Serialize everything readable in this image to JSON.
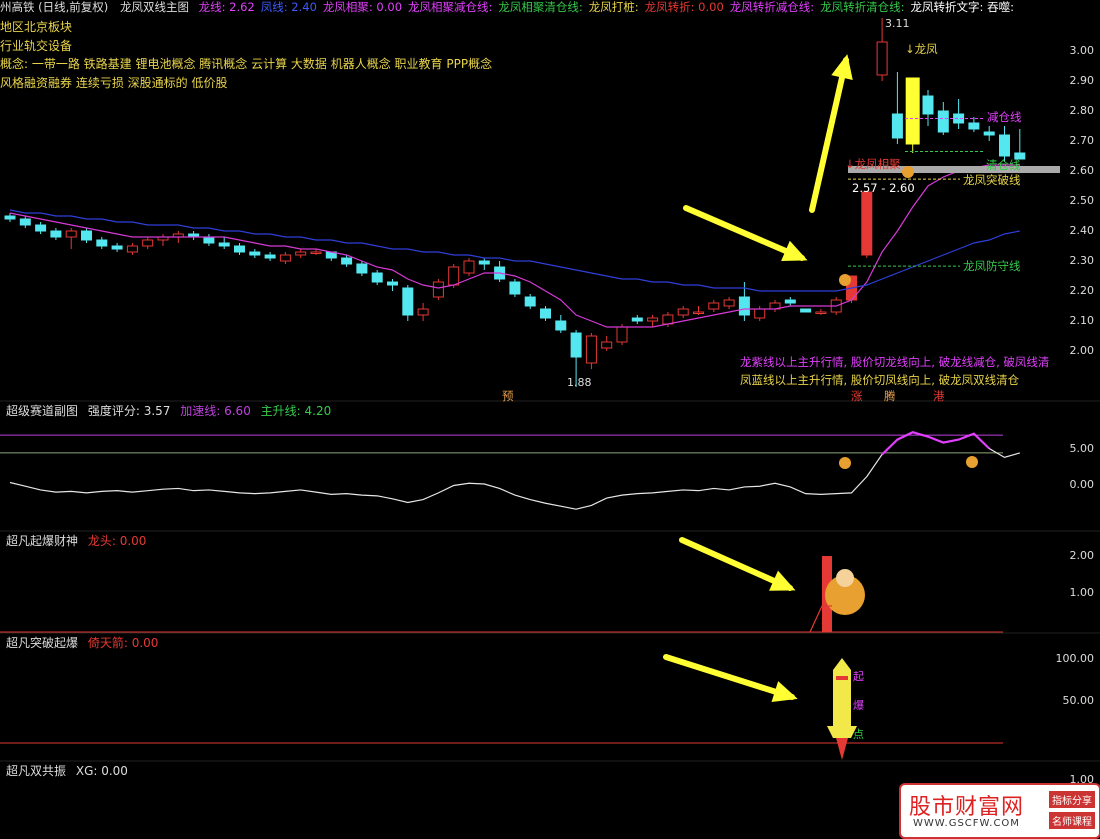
{
  "header": {
    "prefix": "州高铁 (日线,前复权)",
    "title": "龙凤双线主图",
    "items": [
      {
        "label": "龙线: 2.62",
        "color": "#e040fb"
      },
      {
        "label": "凤线: 2.40",
        "color": "#3b5bff"
      },
      {
        "label": "龙凤相聚: 0.00",
        "color": "#e040fb"
      },
      {
        "label": "龙凤相聚减仓线:",
        "color": "#e040fb"
      },
      {
        "label": "龙凤相聚清仓线:",
        "color": "#35c94b"
      },
      {
        "label": "龙凤打桩:",
        "color": "#e8d44a"
      },
      {
        "label": "龙凤转折: 0.00",
        "color": "#e53935"
      },
      {
        "label": "龙凤转折减仓线:",
        "color": "#e040fb"
      },
      {
        "label": "龙凤转折清仓线:",
        "color": "#35c94b"
      },
      {
        "label": "龙凤转折文字: 吞噬:",
        "color": "#ffffff"
      }
    ]
  },
  "concepts": [
    "地区北京板块",
    "行业轨交设备",
    "概念: 一带一路 铁路基建 锂电池概念 腾讯概念 云计算 大数据 机器人概念 职业教育 PPP概念",
    "风格融资融券 连续亏损 深股通标的 低价股"
  ],
  "main_annotations": {
    "high": "3.11",
    "low": "1.88",
    "longfeng": "↓龙凤",
    "xiangju": "↓龙凤相聚",
    "range": "2.57 - 2.60",
    "jiancang": "减仓线",
    "qingcang": "清仓线",
    "tupo": "龙凤突破线",
    "fangshou": "龙凤防守线",
    "note1": "龙紫线以上主升行情, 股价切龙线向上, 破龙线减仓, 破凤线清",
    "note2": "凤蓝线以上主升行情, 股价切凤线向上, 破龙凤双线清仓",
    "marker_yu": "预",
    "marker_zhang": "涨",
    "marker_teng": "腾",
    "marker_gang": "港"
  },
  "yaxis_main": [
    "3.00",
    "2.90",
    "2.80",
    "2.70",
    "2.60",
    "2.50",
    "2.40",
    "2.30",
    "2.20",
    "2.10",
    "2.00"
  ],
  "panel2": {
    "title": "超级赛道副图",
    "score": "强度评分: 3.57",
    "accel": "加速线: 6.60",
    "main": "主升线: 4.20",
    "yaxis": [
      "5.00",
      "0.00"
    ]
  },
  "panel3": {
    "title": "超凡起爆财神",
    "value": "龙头: 0.00",
    "yaxis": [
      "2.00",
      "1.00"
    ]
  },
  "panel4": {
    "title": "超凡突破起爆",
    "value": "倚天箭: 0.00",
    "yaxis": [
      "100.00",
      "50.00"
    ],
    "rocket_labels": [
      "起",
      "爆",
      "点"
    ]
  },
  "panel5": {
    "title": "超凡双共振",
    "value": "XG: 0.00",
    "yaxis": [
      "1.00"
    ]
  },
  "watermark": {
    "cn": "股市财富网",
    "url": "WWW.GSCFW.COM",
    "tag1": "指标分享",
    "tag2": "名师课程"
  },
  "colors": {
    "up": "#e53935",
    "down": "#54e7f0",
    "long": "#d63ad6",
    "feng": "#2f3fd8",
    "yellow": "#ffff33",
    "accel": "#c040e0",
    "mainline": "#8fa878"
  },
  "chart_data": {
    "type": "candlestick",
    "ohlc": [
      [
        2.45,
        2.46,
        2.43,
        2.44
      ],
      [
        2.44,
        2.45,
        2.41,
        2.42
      ],
      [
        2.42,
        2.43,
        2.39,
        2.4
      ],
      [
        2.4,
        2.41,
        2.37,
        2.38
      ],
      [
        2.38,
        2.41,
        2.34,
        2.4
      ],
      [
        2.4,
        2.41,
        2.36,
        2.37
      ],
      [
        2.37,
        2.38,
        2.34,
        2.35
      ],
      [
        2.35,
        2.36,
        2.33,
        2.34
      ],
      [
        2.33,
        2.36,
        2.32,
        2.35
      ],
      [
        2.35,
        2.38,
        2.34,
        2.37
      ],
      [
        2.37,
        2.39,
        2.35,
        2.38
      ],
      [
        2.38,
        2.4,
        2.36,
        2.39
      ],
      [
        2.39,
        2.4,
        2.37,
        2.38
      ],
      [
        2.38,
        2.39,
        2.35,
        2.36
      ],
      [
        2.36,
        2.38,
        2.34,
        2.35
      ],
      [
        2.35,
        2.36,
        2.32,
        2.33
      ],
      [
        2.33,
        2.34,
        2.31,
        2.32
      ],
      [
        2.32,
        2.33,
        2.3,
        2.31
      ],
      [
        2.3,
        2.33,
        2.29,
        2.32
      ],
      [
        2.32,
        2.34,
        2.31,
        2.33
      ],
      [
        2.33,
        2.34,
        2.32,
        2.33
      ],
      [
        2.33,
        2.33,
        2.3,
        2.31
      ],
      [
        2.31,
        2.32,
        2.28,
        2.29
      ],
      [
        2.29,
        2.3,
        2.25,
        2.26
      ],
      [
        2.26,
        2.27,
        2.22,
        2.23
      ],
      [
        2.23,
        2.24,
        2.2,
        2.22
      ],
      [
        2.21,
        2.22,
        2.1,
        2.12
      ],
      [
        2.12,
        2.16,
        2.1,
        2.14
      ],
      [
        2.18,
        2.24,
        2.17,
        2.23
      ],
      [
        2.22,
        2.29,
        2.21,
        2.28
      ],
      [
        2.26,
        2.31,
        2.25,
        2.3
      ],
      [
        2.3,
        2.31,
        2.27,
        2.29
      ],
      [
        2.28,
        2.3,
        2.23,
        2.24
      ],
      [
        2.23,
        2.24,
        2.18,
        2.19
      ],
      [
        2.18,
        2.19,
        2.14,
        2.15
      ],
      [
        2.14,
        2.15,
        2.1,
        2.11
      ],
      [
        2.1,
        2.12,
        2.06,
        2.07
      ],
      [
        2.06,
        2.07,
        1.88,
        1.98
      ],
      [
        1.96,
        2.06,
        1.94,
        2.05
      ],
      [
        2.01,
        2.05,
        2.0,
        2.03
      ],
      [
        2.03,
        2.09,
        2.02,
        2.08
      ],
      [
        2.11,
        2.12,
        2.09,
        2.1
      ],
      [
        2.1,
        2.12,
        2.08,
        2.11
      ],
      [
        2.09,
        2.13,
        2.08,
        2.12
      ],
      [
        2.12,
        2.15,
        2.11,
        2.14
      ],
      [
        2.13,
        2.15,
        2.12,
        2.13
      ],
      [
        2.14,
        2.17,
        2.13,
        2.16
      ],
      [
        2.15,
        2.18,
        2.14,
        2.17
      ],
      [
        2.18,
        2.23,
        2.1,
        2.12
      ],
      [
        2.11,
        2.15,
        2.1,
        2.14
      ],
      [
        2.14,
        2.17,
        2.13,
        2.16
      ],
      [
        2.17,
        2.18,
        2.15,
        2.16
      ],
      [
        2.14,
        2.14,
        2.13,
        2.13
      ],
      [
        2.13,
        2.14,
        2.12,
        2.13
      ],
      [
        2.13,
        2.18,
        2.12,
        2.17
      ],
      [
        2.17,
        2.25,
        2.16,
        2.25
      ],
      [
        2.32,
        2.53,
        2.31,
        2.53
      ],
      [
        2.92,
        3.11,
        2.9,
        3.03
      ],
      [
        2.79,
        2.93,
        2.69,
        2.71
      ],
      [
        2.69,
        2.9,
        2.66,
        2.91
      ],
      [
        2.85,
        2.87,
        2.75,
        2.79
      ],
      [
        2.8,
        2.83,
        2.72,
        2.73
      ],
      [
        2.79,
        2.84,
        2.74,
        2.76
      ],
      [
        2.76,
        2.78,
        2.73,
        2.74
      ],
      [
        2.73,
        2.75,
        2.7,
        2.72
      ],
      [
        2.72,
        2.75,
        2.63,
        2.65
      ],
      [
        2.66,
        2.74,
        2.64,
        2.64
      ]
    ],
    "long_line": [
      2.46,
      2.45,
      2.44,
      2.43,
      2.42,
      2.41,
      2.4,
      2.39,
      2.38,
      2.38,
      2.38,
      2.38,
      2.38,
      2.38,
      2.38,
      2.37,
      2.36,
      2.35,
      2.35,
      2.34,
      2.34,
      2.33,
      2.32,
      2.3,
      2.28,
      2.27,
      2.24,
      2.22,
      2.21,
      2.22,
      2.24,
      2.26,
      2.26,
      2.25,
      2.23,
      2.2,
      2.17,
      2.12,
      2.1,
      2.08,
      2.08,
      2.08,
      2.08,
      2.09,
      2.1,
      2.11,
      2.12,
      2.13,
      2.14,
      2.14,
      2.14,
      2.15,
      2.15,
      2.15,
      2.15,
      2.17,
      2.23,
      2.33,
      2.4,
      2.48,
      2.55,
      2.58,
      2.6,
      2.61,
      2.62,
      2.62,
      2.62
    ],
    "feng_line": [
      2.47,
      2.46,
      2.46,
      2.45,
      2.45,
      2.44,
      2.44,
      2.43,
      2.43,
      2.42,
      2.42,
      2.42,
      2.41,
      2.41,
      2.4,
      2.4,
      2.39,
      2.39,
      2.38,
      2.38,
      2.37,
      2.37,
      2.36,
      2.36,
      2.35,
      2.34,
      2.34,
      2.33,
      2.33,
      2.32,
      2.32,
      2.31,
      2.31,
      2.3,
      2.3,
      2.29,
      2.28,
      2.27,
      2.26,
      2.25,
      2.24,
      2.24,
      2.23,
      2.23,
      2.22,
      2.22,
      2.21,
      2.21,
      2.21,
      2.2,
      2.2,
      2.2,
      2.2,
      2.2,
      2.2,
      2.21,
      2.22,
      2.24,
      2.26,
      2.28,
      2.3,
      2.32,
      2.34,
      2.36,
      2.37,
      2.39,
      2.4
    ],
    "osc": [
      0.2,
      -0.3,
      -0.8,
      -1.1,
      -1.0,
      -1.2,
      -1.0,
      -0.9,
      -1.1,
      -0.9,
      -0.7,
      -0.6,
      -0.9,
      -0.8,
      -1.0,
      -1.2,
      -1.3,
      -1.2,
      -1.0,
      -0.8,
      -1.1,
      -1.4,
      -1.3,
      -1.5,
      -1.6,
      -2.0,
      -2.5,
      -2.1,
      -1.2,
      -0.2,
      0.1,
      0.0,
      -0.6,
      -1.5,
      -2.1,
      -2.6,
      -3.0,
      -3.4,
      -2.9,
      -1.9,
      -1.5,
      -1.3,
      -1.2,
      -1.0,
      -0.8,
      -0.9,
      -0.6,
      -0.8,
      -0.4,
      -0.3,
      0.1,
      -0.4,
      -1.3,
      -1.4,
      -1.3,
      -1.2,
      1.0,
      4.0,
      6.0,
      7.0,
      6.4,
      5.6,
      6.0,
      6.8,
      4.8,
      3.6,
      4.2
    ],
    "accel_line": 6.6,
    "main_line": 4.2
  }
}
